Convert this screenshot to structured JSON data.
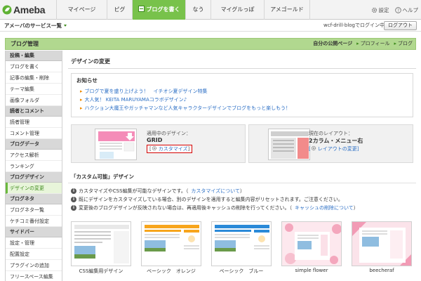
{
  "topbar": {
    "logo_text": "Ameba",
    "nav": [
      {
        "label": "マイページ",
        "width": 72
      },
      {
        "label": "ピグ",
        "width": 36
      },
      {
        "label": "ブログを書く",
        "width": 76,
        "active": true
      },
      {
        "label": "なう",
        "width": 36
      },
      {
        "label": "マイグルっぽ",
        "width": 76
      },
      {
        "label": "アメゴールド",
        "width": 66
      }
    ],
    "settings_label": "設定",
    "help_label": "ヘルプ"
  },
  "servicebar": {
    "service_menu": "アメーバのサービス一覧",
    "login_status": "wcf-drill-blogでログイン中",
    "logout": "ログアウト"
  },
  "admin_header": {
    "title": "ブログ管理",
    "links": [
      {
        "label": "自分の公開ページ",
        "bold": true,
        "arrow": false
      },
      {
        "label": "プロフィール",
        "bold": false,
        "arrow": true
      },
      {
        "label": "ブログ",
        "bold": false,
        "arrow": true
      }
    ]
  },
  "sidebar": {
    "sections": [
      {
        "head": "投稿・編集",
        "items": [
          "ブログを書く",
          "記事の編集・削除",
          "テーマ編集",
          "画像フォルダ"
        ]
      },
      {
        "head": "読者とコメント",
        "items": [
          "読者管理",
          "コメント管理"
        ]
      },
      {
        "head": "ブログデータ",
        "items": [
          "アクセス解析",
          "ランキング"
        ]
      },
      {
        "head": "ブログデザイン",
        "items": [
          "デザインの変更"
        ],
        "active_item": "デザインの変更"
      },
      {
        "head": "ブログネタ",
        "items": [
          "ブログネタ一覧",
          "ケチコミ番付設定"
        ]
      },
      {
        "head": "サイドバー",
        "items": [
          "設定・管理",
          "配置設定",
          "プラグインの追加",
          "フリースペース編集"
        ]
      }
    ]
  },
  "main": {
    "page_heading": "デザインの変更",
    "notice": {
      "title": "お知らせ",
      "items": [
        "ブログで夏を盛り上げよう！　イチオシ夏デザイン特集",
        "大人気！ KEITA MARUYAMAコラボデザイン♪",
        "ハクション大魔王やガッチャマンなど人気キャラクターデザインでブログをもっと楽しもう！"
      ]
    },
    "current_design": {
      "label": "適用中のデザイン：",
      "value": "GRID",
      "customize_label": "カスタマイズ"
    },
    "current_layout": {
      "label": "現在のレイアウト：",
      "value": "2カラム・メニュー右",
      "change_label": "レイアウトの変更"
    },
    "custom_heading": "「カスタム可能」デザイン",
    "info": [
      {
        "text": "カスタマイズやCSS編集が可能なデザインです。（",
        "link": "カスタマイズについて",
        "tail": "）"
      },
      {
        "text": "既にデザインをカスタマイズしている場合、別のデザインを適用すると編集内容がリセットされます。ご注意ください。",
        "link": "",
        "tail": ""
      },
      {
        "text": "変更後のブログデザインが反映されない場合は、再適用後キャッシュの削除を行ってください。（",
        "link": "キャッシュの削除について",
        "tail": "）"
      }
    ],
    "designs": [
      {
        "label": "CSS編集用デザイン"
      },
      {
        "label": "ベーシック　オレンジ"
      },
      {
        "label": "ベーシック　ブルー"
      },
      {
        "label": "simple flower"
      },
      {
        "label": "beecheraf"
      }
    ]
  },
  "colors": {
    "brand_green": "#78c24b",
    "header_green": "#b1d88f",
    "link_blue": "#2a6ec5",
    "highlight_red": "#d40000",
    "arrow_orange": "#ef8b00"
  }
}
